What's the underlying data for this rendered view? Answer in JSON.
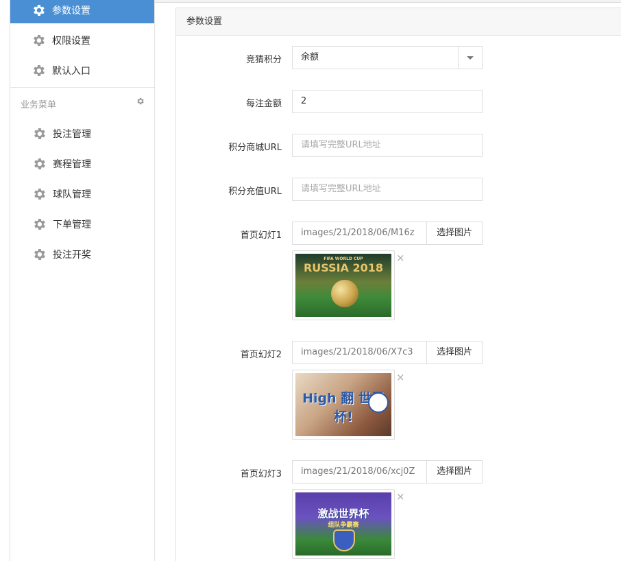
{
  "sidebar": {
    "items": [
      {
        "label": "参数设置",
        "icon": "gear-icon",
        "active": true
      },
      {
        "label": "权限设置",
        "icon": "gear-icon"
      },
      {
        "label": "默认入口",
        "icon": "gear-icon"
      }
    ],
    "section_title": "业务菜单",
    "section_items": [
      {
        "label": "投注管理",
        "icon": "gear-icon"
      },
      {
        "label": "赛程管理",
        "icon": "gear-icon"
      },
      {
        "label": "球队管理",
        "icon": "gear-icon"
      },
      {
        "label": "下单管理",
        "icon": "gear-icon"
      },
      {
        "label": "投注开奖",
        "icon": "gear-icon"
      }
    ]
  },
  "panel": {
    "title": "参数设置",
    "fields": {
      "guess_points": {
        "label": "竞猜积分",
        "value": "余额"
      },
      "bet_amount": {
        "label": "每注金额",
        "value": "2"
      },
      "mall_url": {
        "label": "积分商城URL",
        "placeholder": "请填写完整URL地址"
      },
      "recharge_url": {
        "label": "积分充值URL",
        "placeholder": "请填写完整URL地址"
      }
    },
    "slides": [
      {
        "label": "首页幻灯1",
        "path": "images/21/2018/06/M16z",
        "button": "选择图片",
        "image_caption": "RUSSIA 2018",
        "image_subcaption": "FIFA WORLD CUP"
      },
      {
        "label": "首页幻灯2",
        "path": "images/21/2018/06/X7c3",
        "button": "选择图片",
        "image_caption": "High 翻 世界杯!"
      },
      {
        "label": "首页幻灯3",
        "path": "images/21/2018/06/xcj0Z",
        "button": "选择图片",
        "image_caption": "激战世界杯",
        "image_subcaption": "组队争霸赛"
      }
    ],
    "close_glyph": "×"
  },
  "colors": {
    "accent": "#4a8fd3",
    "border": "#dedede"
  }
}
